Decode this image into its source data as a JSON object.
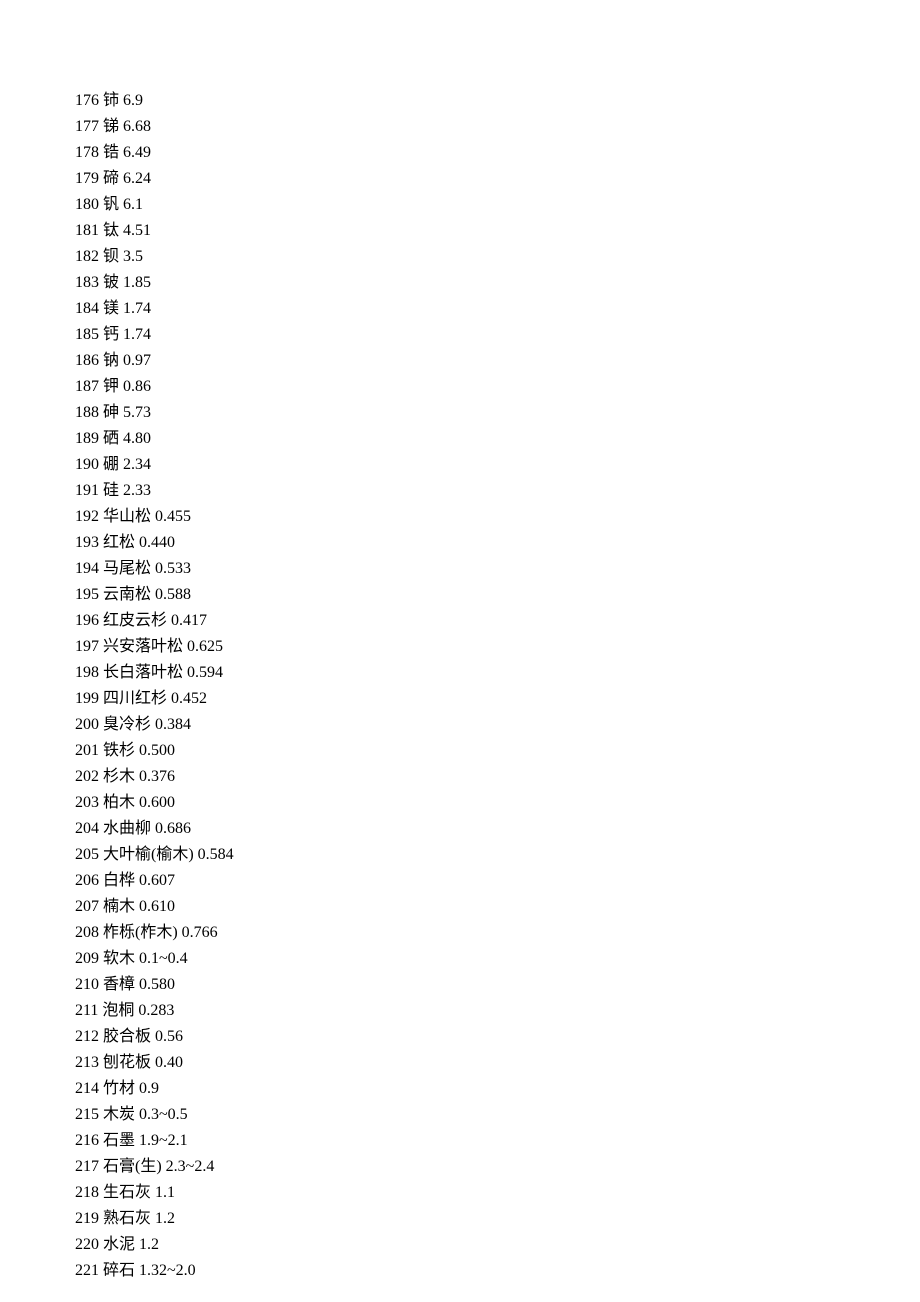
{
  "rows": [
    {
      "num": "176",
      "name": "铈",
      "value": "6.9"
    },
    {
      "num": "177",
      "name": "锑",
      "value": "6.68"
    },
    {
      "num": "178",
      "name": "锆",
      "value": "6.49"
    },
    {
      "num": "179",
      "name": "碲",
      "value": "6.24"
    },
    {
      "num": "180",
      "name": "钒",
      "value": "6.1"
    },
    {
      "num": "181",
      "name": "钛",
      "value": "4.51"
    },
    {
      "num": "182",
      "name": "钡",
      "value": "3.5"
    },
    {
      "num": "183",
      "name": "铍",
      "value": "1.85"
    },
    {
      "num": "184",
      "name": "镁",
      "value": "1.74"
    },
    {
      "num": "185",
      "name": "钙",
      "value": "1.74"
    },
    {
      "num": "186",
      "name": "钠",
      "value": "0.97"
    },
    {
      "num": "187",
      "name": "钾",
      "value": "0.86"
    },
    {
      "num": "188",
      "name": "砷",
      "value": "5.73"
    },
    {
      "num": "189",
      "name": "硒",
      "value": "4.80"
    },
    {
      "num": "190",
      "name": "硼",
      "value": "2.34"
    },
    {
      "num": "191",
      "name": "硅",
      "value": "2.33"
    },
    {
      "num": "192",
      "name": "华山松",
      "value": "0.455"
    },
    {
      "num": "193",
      "name": "红松",
      "value": "0.440"
    },
    {
      "num": "194",
      "name": "马尾松",
      "value": "0.533"
    },
    {
      "num": "195",
      "name": "云南松",
      "value": "0.588"
    },
    {
      "num": "196",
      "name": "红皮云杉",
      "value": "0.417"
    },
    {
      "num": "197",
      "name": "兴安落叶松",
      "value": "0.625"
    },
    {
      "num": "198",
      "name": "长白落叶松",
      "value": "0.594"
    },
    {
      "num": "199",
      "name": "四川红杉",
      "value": "0.452"
    },
    {
      "num": "200",
      "name": "臭冷杉",
      "value": "0.384"
    },
    {
      "num": "201",
      "name": "铁杉",
      "value": "0.500"
    },
    {
      "num": "202",
      "name": "杉木",
      "value": "0.376"
    },
    {
      "num": "203",
      "name": "柏木",
      "value": "0.600"
    },
    {
      "num": "204",
      "name": "水曲柳",
      "value": "0.686"
    },
    {
      "num": "205",
      "name": "大叶榆(榆木)",
      "value": "0.584"
    },
    {
      "num": "206",
      "name": "白桦",
      "value": "0.607"
    },
    {
      "num": "207",
      "name": "楠木",
      "value": "0.610"
    },
    {
      "num": "208",
      "name": "柞栎(柞木)",
      "value": "0.766"
    },
    {
      "num": "209",
      "name": "软木",
      "value": "0.1~0.4"
    },
    {
      "num": "210",
      "name": "香樟",
      "value": "0.580"
    },
    {
      "num": "211",
      "name": "泡桐",
      "value": "0.283"
    },
    {
      "num": "212",
      "name": "胶合板",
      "value": "0.56"
    },
    {
      "num": "213",
      "name": "刨花板",
      "value": "0.40"
    },
    {
      "num": "214",
      "name": "竹材",
      "value": "0.9"
    },
    {
      "num": "215",
      "name": "木炭",
      "value": "0.3~0.5"
    },
    {
      "num": "216",
      "name": "石墨",
      "value": "1.9~2.1"
    },
    {
      "num": "217",
      "name": "石膏(生)",
      "value": "2.3~2.4"
    },
    {
      "num": "218",
      "name": "生石灰",
      "value": "1.1"
    },
    {
      "num": "219",
      "name": "熟石灰",
      "value": "1.2"
    },
    {
      "num": "220",
      "name": "水泥",
      "value": "1.2"
    },
    {
      "num": "221",
      "name": "碎石",
      "value": "1.32~2.0"
    }
  ]
}
